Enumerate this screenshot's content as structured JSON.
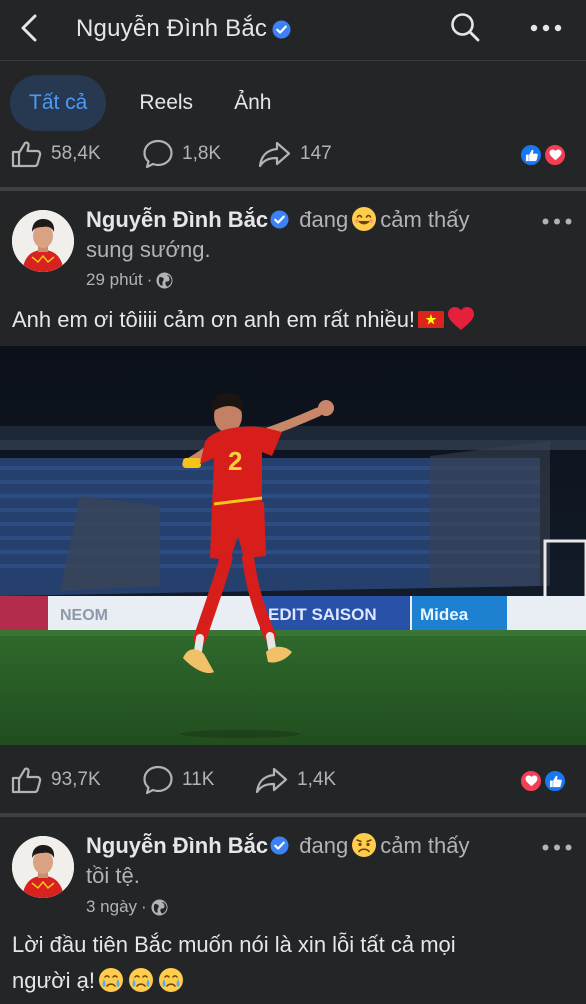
{
  "header": {
    "title": "Nguyễn Đình Bắc",
    "back_icon": "chevron-left-icon",
    "search_icon": "search-icon",
    "more_icon": "more-horizontal-icon"
  },
  "tabs": [
    {
      "label": "Tất cả",
      "active": true
    },
    {
      "label": "Reels",
      "active": false
    },
    {
      "label": "Ảnh",
      "active": false
    }
  ],
  "top_post_stats": {
    "likes": "58,4K",
    "comments": "1,8K",
    "shares": "147",
    "reactions": [
      "like",
      "love"
    ]
  },
  "posts": [
    {
      "author": "Nguyễn Đình Bắc",
      "feeling_prefix": "đang",
      "feeling_emoji": "smiling-face-icon",
      "feeling_suffix": "cảm thấy",
      "feeling": "sung sướng.",
      "time": "29 phút",
      "privacy_icon": "globe-icon",
      "text": "Anh em ơi tôiiii cảm ơn anh em rất nhiều!",
      "text_emojis": [
        "vietnam-flag-icon",
        "red-heart-icon"
      ],
      "photo": "football-player-celebrating-image",
      "stats": {
        "likes": "93,7K",
        "comments": "11K",
        "shares": "1,4K",
        "reactions": [
          "love",
          "like"
        ]
      }
    },
    {
      "author": "Nguyễn Đình Bắc",
      "feeling_prefix": "đang",
      "feeling_emoji": "worried-face-icon",
      "feeling_suffix": "cảm thấy",
      "feeling": "tồi tệ.",
      "time": "3 ngày",
      "privacy_icon": "globe-icon",
      "text_line1": "Lời đầu tiên Bắc muốn nói là xin lỗi tất cả mọi",
      "text_line2": "người ạ!",
      "text_emojis": [
        "crying-face-icon",
        "crying-face-icon",
        "crying-face-icon"
      ]
    }
  ],
  "colors": {
    "background": "#242526",
    "text_primary": "#e4e6eb",
    "text_secondary": "#b0b3b8",
    "accent": "#4d99f5",
    "active_tab_bg": "#263951",
    "verified": "#3b82f6",
    "like": "#1877f2",
    "love": "#f33e58"
  }
}
